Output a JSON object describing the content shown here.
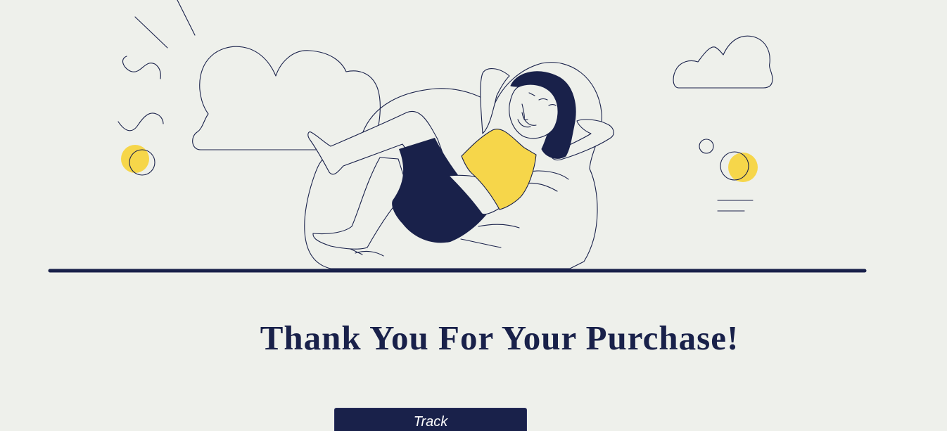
{
  "illustration": {
    "icon": "woman-relaxing-on-beanbag",
    "colors": {
      "navy": "#19214a",
      "yellow": "#f6d64a",
      "background": "#eef0eb"
    }
  },
  "thank_you": {
    "title": "Thank You For Your Purchase!"
  },
  "actions": {
    "track_label": "Track"
  }
}
